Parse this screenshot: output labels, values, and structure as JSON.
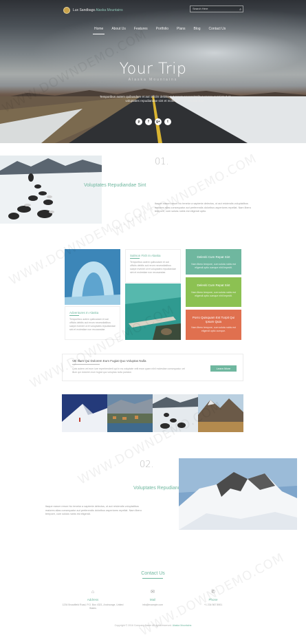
{
  "header": {
    "brand_prefix": "Lux Sandbags",
    "brand_name": "Alaska Mountains",
    "search_placeholder": "Search Here",
    "nav": [
      "Home",
      "About Us",
      "Features",
      "Portfolio",
      "Plans",
      "Blog",
      "Contact Us"
    ],
    "active_nav_index": 0
  },
  "hero": {
    "title": "Your Trip",
    "subtitle": "Alaska Mountains",
    "text": "Temporibus autem quibusdam et aut officiis debitis aut rerum necessitatibus saepe eveniet ut et voluptates repudiandae sint et molestiae non recusandae.",
    "social": [
      "p",
      "f",
      "g+",
      "t"
    ]
  },
  "section1": {
    "number": "01.",
    "heading": "Voluptates Repudiandae Sint",
    "paragraph": "Itaque earum rerum hic tenetur a sapiente delectus, ut aut reiciendis voluptatibus maiores alias consequatur aut perferendis doloribus asperiores repellat. Nam libero tempore, cum soluta nobis est eligendi optio."
  },
  "features": {
    "card_top": {
      "title": "Salmon Fish In Alaska",
      "text": "Temporibus autem quibusdam et aut officiis debitis aut rerum necessitatibus saepe eveniet ut et voluptates repudiandae sint et molestiae non recusandae."
    },
    "card_bottom": {
      "title": "Adventures In Alaska",
      "text": "Temporibus autem quibusdam et aut officiis debitis aut rerum necessitatibus saepe eveniet ut et voluptates repudiandae sint et molestiae non recusandae."
    },
    "tiles": [
      {
        "title": "Deleniti Cum Repat Sint",
        "text": "Nam libero tempore, cum soluta nobis est eligendi optio cumque nihil impedit."
      },
      {
        "title": "Deleniti Cum Repat Sint",
        "text": "Nam libero tempore, cum soluta nobis est eligendi optio cumque nihil impedit."
      },
      {
        "title": "Porro Quisquam Est Turpit Qui Ipsum Quia",
        "text": "Nam libero tempore, cum soluta nobis est eligendi optio cumque."
      }
    ],
    "tile_colors": [
      "#6fb79f",
      "#8cc152",
      "#e0704f"
    ]
  },
  "info_box": {
    "heading": "Vel Illum Qui Dolorem Eum Fugiat Quo Voluptas Nulla",
    "text": "Quis autem vel eum iure reprehenderit qui in ea voluptate velit esse quam nihil molestiae consequatur, vel illum qui dolorem eum fugiat quo voluptas nulla pariatur.",
    "button": "Learn More"
  },
  "section2": {
    "number": "02.",
    "heading": "Voluptates Repudiandae Sint",
    "paragraph": "Itaque earum rerum hic tenetur a sapiente delectus, ut aut reiciendis voluptatibus maiores alias consequatur aut perferendis doloribus asperiores repellat. Nam libero tempore, cum soluta nobis est eligendi."
  },
  "contact": {
    "title": "Contact Us",
    "columns": [
      {
        "icon": "home-icon",
        "glyph": "⌂",
        "label": "Address",
        "text": "1234 Broadfield Road, P.O. Box 4321, Anchorage, United States"
      },
      {
        "icon": "mail-icon",
        "glyph": "✉",
        "label": "Mail",
        "text": "info@example.com"
      },
      {
        "icon": "phone-icon",
        "glyph": "✆",
        "label": "Phone",
        "text": "+1 234 567 8901"
      }
    ]
  },
  "footer": {
    "text": "Copyright © 2016 Company Name All rights reserved.",
    "link": "Alaska Mountains"
  },
  "watermark": "WWW.DOWNDEMO.COM",
  "accent_color": "#6fb79f"
}
